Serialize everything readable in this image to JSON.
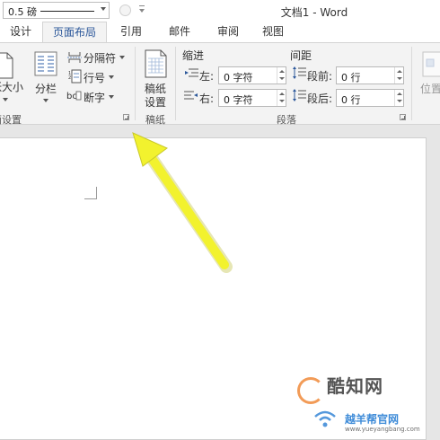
{
  "titlebar": {
    "weight_value": "0.5 磅",
    "doc_title": "文档1 - Word"
  },
  "tabs": [
    {
      "label": "设计"
    },
    {
      "label": "页面布局"
    },
    {
      "label": "引用"
    },
    {
      "label": "邮件"
    },
    {
      "label": "审阅"
    },
    {
      "label": "视图"
    }
  ],
  "ribbon": {
    "page_setup": {
      "size_label": "纸张大小",
      "columns_label": "分栏",
      "breaks_label": "分隔符",
      "line_numbers_label": "行号",
      "hyphenation_label": "断字",
      "group_label": "页面设置"
    },
    "draft": {
      "button_line1": "稿纸",
      "button_line2": "设置",
      "group_label": "稿纸"
    },
    "paragraph": {
      "indent_header": "缩进",
      "spacing_header": "间距",
      "left_label": "左:",
      "right_label": "右:",
      "before_label": "段前:",
      "after_label": "段后:",
      "left_value": "0 字符",
      "right_value": "0 字符",
      "before_value": "0 行",
      "after_value": "0 行",
      "group_label": "段落"
    },
    "arrange": {
      "position_label": "位置"
    }
  },
  "watermark": {
    "site_name": "酷知网",
    "site_name2": "越羊帮官网",
    "site_url": "www.yueyangbang.com"
  },
  "colors": {
    "accent": "#2b579a",
    "arrow": "#f2f22e",
    "ribbon_bg": "#f3f3f3"
  }
}
